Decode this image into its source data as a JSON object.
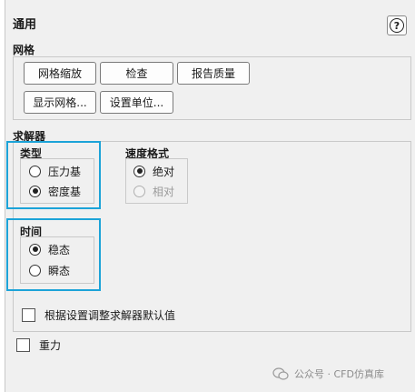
{
  "header": {
    "title": "通用",
    "help_icon": "question-icon",
    "help_glyph": "?"
  },
  "mesh": {
    "label": "网格",
    "buttons": [
      "网格缩放",
      "检查",
      "报告质量",
      "显示网格...",
      "设置单位..."
    ]
  },
  "solver": {
    "label": "求解器",
    "type": {
      "label": "类型",
      "options": [
        "压力基",
        "密度基"
      ],
      "selected": "密度基"
    },
    "velocity": {
      "label": "速度格式",
      "options": [
        "绝对",
        "相对"
      ],
      "selected": "绝对",
      "disabled_options": [
        "相对"
      ]
    },
    "time": {
      "label": "时间",
      "options": [
        "稳态",
        "瞬态"
      ],
      "selected": "稳态"
    },
    "adjust_defaults": {
      "label": "根据设置调整求解器默认值",
      "checked": false
    }
  },
  "gravity": {
    "label": "重力",
    "checked": false
  },
  "watermark": {
    "text": "公众号 · CFD仿真库",
    "icon": "wechat-icon"
  },
  "colors": {
    "highlight": "#1ca3d8",
    "panel_bg": "#f0f0f0"
  }
}
